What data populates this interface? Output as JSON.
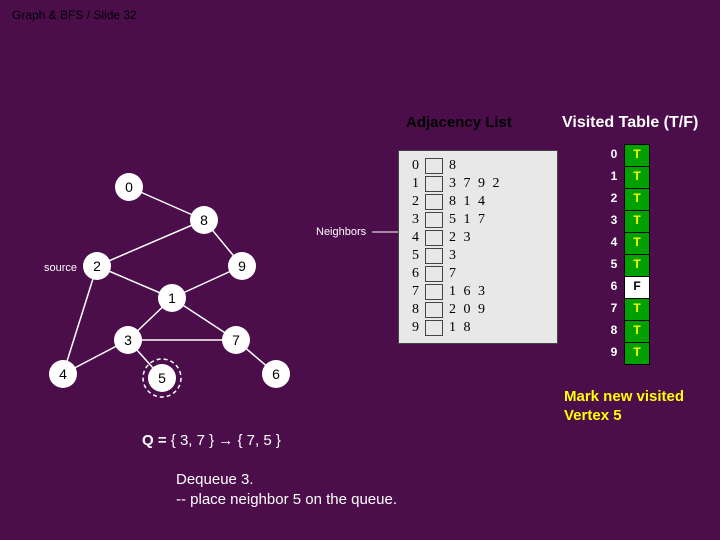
{
  "breadcrumb": "Graph & BFS / Slide 32",
  "headings": {
    "adjacency": "Adjacency List",
    "visited": "Visited Table (T/F)"
  },
  "source_label": "source",
  "neighbors_label": "Neighbors",
  "nodes": {
    "n0": "0",
    "n1": "1",
    "n2": "2",
    "n3": "3",
    "n4": "4",
    "n5": "5",
    "n6": "6",
    "n7": "7",
    "n8": "8",
    "n9": "9"
  },
  "adjacency": [
    {
      "i": "0",
      "vals": "8"
    },
    {
      "i": "1",
      "vals": "3  7  9  2"
    },
    {
      "i": "2",
      "vals": "8  1  4"
    },
    {
      "i": "3",
      "vals": "5  1  7"
    },
    {
      "i": "4",
      "vals": "2  3"
    },
    {
      "i": "5",
      "vals": "3"
    },
    {
      "i": "6",
      "vals": "7"
    },
    {
      "i": "7",
      "vals": "1  6  3"
    },
    {
      "i": "8",
      "vals": "2  0  9"
    },
    {
      "i": "9",
      "vals": "1  8"
    }
  ],
  "visited": [
    {
      "i": "0",
      "v": "T"
    },
    {
      "i": "1",
      "v": "T"
    },
    {
      "i": "2",
      "v": "T"
    },
    {
      "i": "3",
      "v": "T"
    },
    {
      "i": "4",
      "v": "T"
    },
    {
      "i": "5",
      "v": "T"
    },
    {
      "i": "6",
      "v": "F"
    },
    {
      "i": "7",
      "v": "T"
    },
    {
      "i": "8",
      "v": "T"
    },
    {
      "i": "9",
      "v": "T"
    }
  ],
  "note_line1": "Mark new visited",
  "note_line2": "Vertex 5",
  "queue_label": "Q = ",
  "queue_value": "{ 3, 7 } → { 7, 5 }",
  "explain_l1": "Dequeue 3.",
  "explain_l2": "  -- place neighbor 5 on the queue.",
  "chart_data": {
    "type": "table",
    "title": "BFS state at slide 32",
    "graph_nodes": [
      0,
      1,
      2,
      3,
      4,
      5,
      6,
      7,
      8,
      9
    ],
    "graph_edges": [
      [
        0,
        8
      ],
      [
        8,
        2
      ],
      [
        8,
        9
      ],
      [
        2,
        1
      ],
      [
        2,
        4
      ],
      [
        1,
        3
      ],
      [
        1,
        7
      ],
      [
        1,
        9
      ],
      [
        3,
        4
      ],
      [
        3,
        5
      ],
      [
        3,
        7
      ],
      [
        7,
        6
      ]
    ],
    "source_node": 2,
    "current_dequeued": 3,
    "placed_on_queue": 5,
    "queue_before": [
      3,
      7
    ],
    "queue_after": [
      7,
      5
    ],
    "adjacency_list": {
      "0": [
        8
      ],
      "1": [
        3,
        7,
        9,
        2
      ],
      "2": [
        8,
        1,
        4
      ],
      "3": [
        5,
        1,
        7
      ],
      "4": [
        2,
        3
      ],
      "5": [
        3
      ],
      "6": [
        7
      ],
      "7": [
        1,
        6,
        3
      ],
      "8": [
        2,
        0,
        9
      ],
      "9": [
        1,
        8
      ]
    },
    "visited_table": {
      "0": "T",
      "1": "T",
      "2": "T",
      "3": "T",
      "4": "T",
      "5": "T",
      "6": "F",
      "7": "T",
      "8": "T",
      "9": "T"
    }
  }
}
